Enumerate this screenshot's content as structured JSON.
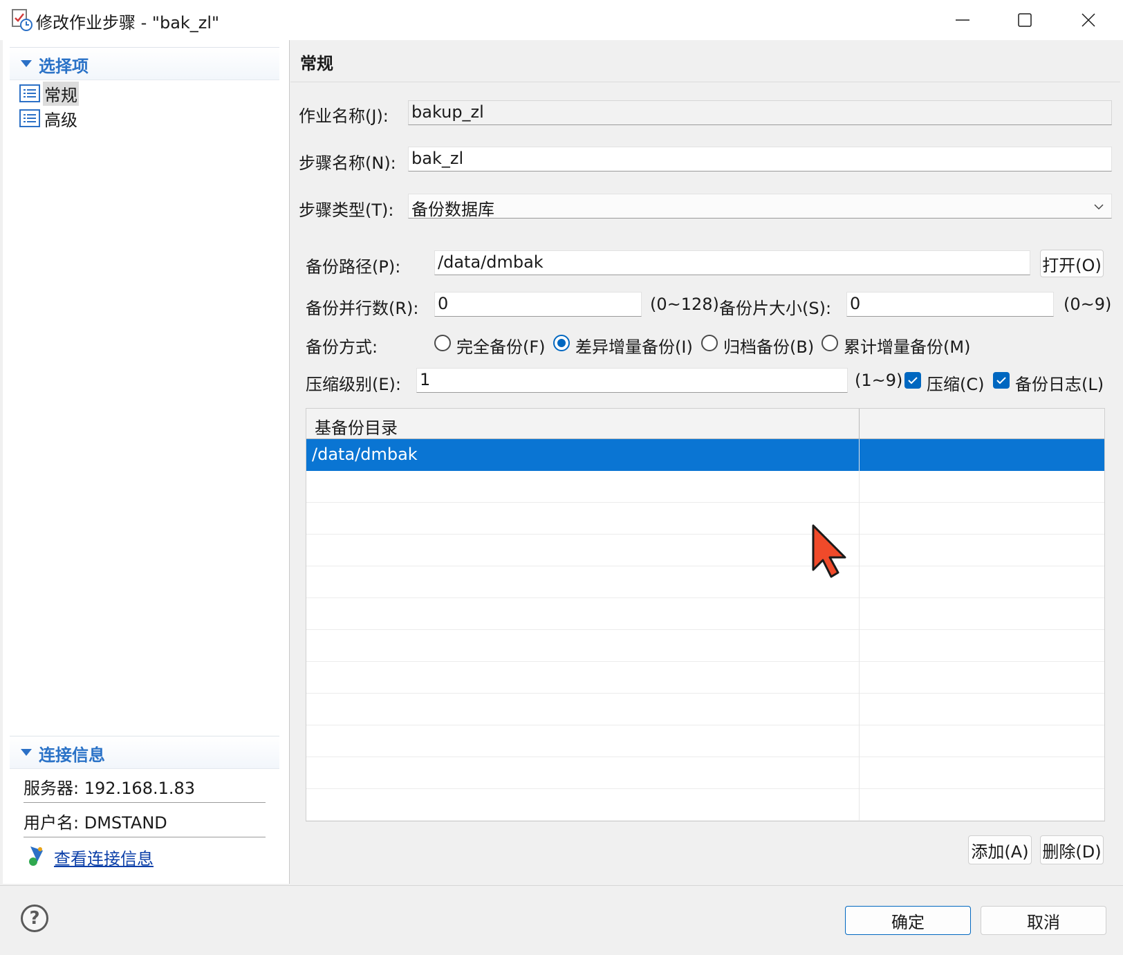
{
  "window": {
    "title": "修改作业步骤 - \"bak_zl\"",
    "minimize": "minimize",
    "maximize": "maximize",
    "close": "close"
  },
  "left": {
    "selection_header": "选择项",
    "nav_items": [
      {
        "label": "常规",
        "selected": true
      },
      {
        "label": "高级",
        "selected": false
      }
    ],
    "connection_header": "连接信息",
    "server_line": "服务器: 192.168.1.83",
    "user_line": "用户名: DMSTAND",
    "view_link": "查看连接信息"
  },
  "main": {
    "section_title": "常规",
    "job_name_label": "作业名称(J):",
    "job_name_value": "bakup_zl",
    "step_name_label": "步骤名称(N):",
    "step_name_value": "bak_zl",
    "step_type_label": "步骤类型(T):",
    "step_type_value": "备份数据库",
    "backup_path_label": "备份路径(P):",
    "backup_path_value": "/data/dmbak",
    "open_button": "打开(O)",
    "parallel_label": "备份并行数(R):",
    "parallel_value": "0",
    "parallel_range": "(0~128)",
    "piece_label": "备份片大小(S):",
    "piece_value": "0",
    "piece_range": "(0~9)",
    "mode_label": "备份方式:",
    "modes": [
      {
        "label": "完全备份(F)",
        "checked": false
      },
      {
        "label": "差异增量备份(I)",
        "checked": true
      },
      {
        "label": "归档备份(B)",
        "checked": false
      },
      {
        "label": "累计增量备份(M)",
        "checked": false
      }
    ],
    "compress_level_label": "压缩级别(E):",
    "compress_level_value": "1",
    "compress_range": "(1~9)",
    "compress_checkbox": "压缩(C)",
    "backup_log_checkbox": "备份日志(L)",
    "table": {
      "column": "基备份目录",
      "rows": [
        "/data/dmbak",
        "",
        "",
        "",
        "",
        "",
        "",
        "",
        "",
        "",
        "",
        ""
      ],
      "selected_row": 0
    },
    "add_button": "添加(A)",
    "delete_button": "删除(D)"
  },
  "footer": {
    "ok_button": "确定",
    "cancel_button": "取消"
  },
  "colors": {
    "accent": "#0067c0",
    "selection": "#0a75d3",
    "section_header_text": "#2a72c7"
  }
}
